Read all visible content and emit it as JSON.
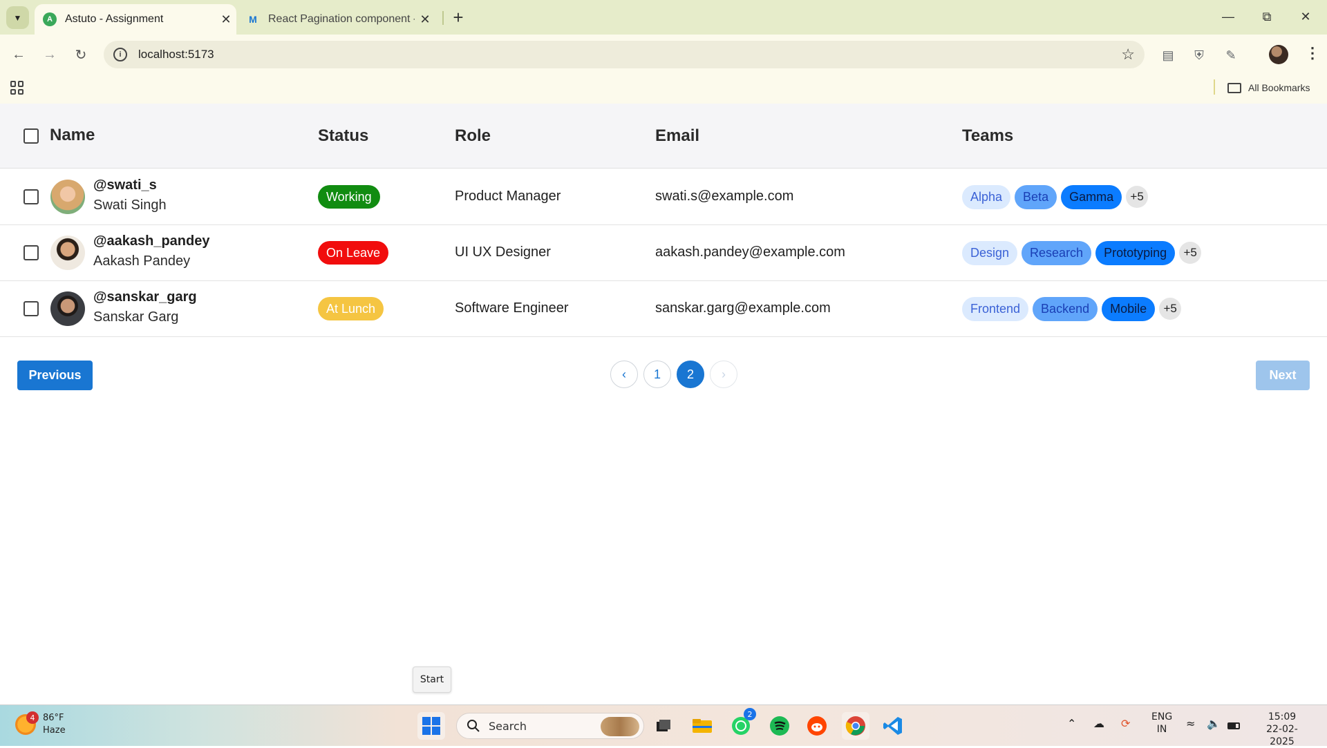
{
  "browser": {
    "tabs": [
      {
        "title": "Astuto - Assignment",
        "active": true
      },
      {
        "title": "React Pagination component - ",
        "active": false
      }
    ],
    "url": "localhost:5173",
    "bookmarks_all": "All Bookmarks"
  },
  "table": {
    "headers": {
      "name": "Name",
      "status": "Status",
      "role": "Role",
      "email": "Email",
      "teams": "Teams"
    },
    "rows": [
      {
        "handle": "@swati_s",
        "name": "Swati Singh",
        "status": "Working",
        "status_color": "#118c11",
        "role": "Product Manager",
        "email": "swati.s@example.com",
        "teams": [
          "Alpha",
          "Beta",
          "Gamma"
        ],
        "more": "+5"
      },
      {
        "handle": "@aakash_pandey",
        "name": "Aakash Pandey",
        "status": "On Leave",
        "status_color": "#f10d0d",
        "role": "UI UX Designer",
        "email": "aakash.pandey@example.com",
        "teams": [
          "Design",
          "Research",
          "Prototyping"
        ],
        "more": "+5"
      },
      {
        "handle": "@sanskar_garg",
        "name": "Sanskar Garg",
        "status": "At Lunch",
        "status_color": "#f5c542",
        "role": "Software Engineer",
        "email": "sanskar.garg@example.com",
        "teams": [
          "Frontend",
          "Backend",
          "Mobile"
        ],
        "more": "+5"
      }
    ]
  },
  "pagination": {
    "previous": "Previous",
    "next": "Next",
    "pages": [
      "1",
      "2"
    ],
    "current_page": "2"
  },
  "tooltip": "Start",
  "taskbar": {
    "weather_temp": "86°F",
    "weather_desc": "Haze",
    "weather_badge": "4",
    "search_label": "Search",
    "whatsapp_badge": "2",
    "lang": "ENG",
    "region": "IN",
    "time": "15:09",
    "date": "22-02-2025"
  },
  "colors": {
    "primary": "#1976d2",
    "chip_light": "#dbeafe",
    "chip_mid": "#60a5fa",
    "chip_dark": "#0b7cff"
  }
}
